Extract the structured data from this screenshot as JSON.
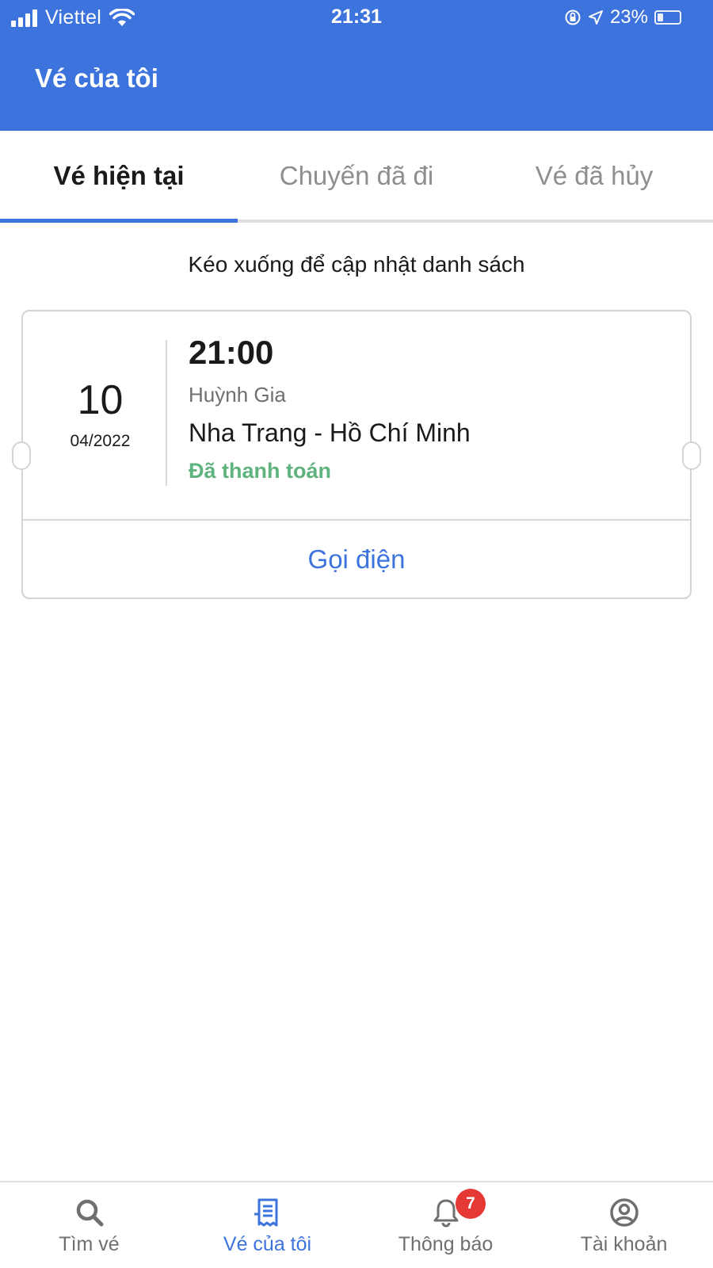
{
  "status_bar": {
    "carrier": "Viettel",
    "time": "21:31",
    "battery": "23%"
  },
  "header": {
    "title": "Vé của tôi"
  },
  "tabs": [
    {
      "label": "Vé hiện tại",
      "active": true
    },
    {
      "label": "Chuyến đã đi",
      "active": false
    },
    {
      "label": "Vé đã hủy",
      "active": false
    }
  ],
  "hint": "Kéo xuống để cập nhật danh sách",
  "ticket": {
    "day": "10",
    "month_year": "04/2022",
    "time": "21:00",
    "company": "Huỳnh Gia",
    "route": "Nha Trang - Hồ Chí Minh",
    "status": "Đã thanh toán",
    "call_label": "Gọi điện"
  },
  "bottom_nav": [
    {
      "label": "Tìm vé",
      "icon": "search-icon",
      "active": false
    },
    {
      "label": "Vé của tôi",
      "icon": "ticket-icon",
      "active": true
    },
    {
      "label": "Thông báo",
      "icon": "bell-icon",
      "active": false,
      "badge": "7"
    },
    {
      "label": "Tài khoản",
      "icon": "account-icon",
      "active": false
    }
  ],
  "colors": {
    "primary": "#3d73dc",
    "paid_status": "#5fb37e",
    "badge": "#e53935",
    "inactive": "#8e8e8e"
  }
}
